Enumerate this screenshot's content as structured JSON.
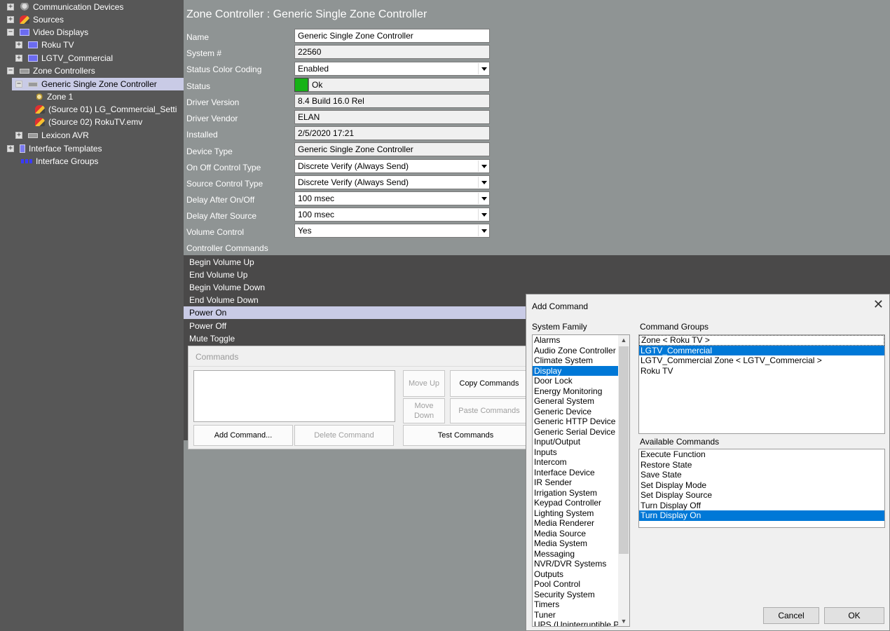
{
  "tree": {
    "items": [
      {
        "label": "Communication Devices",
        "expander": "+",
        "icon": "comm-device-icon"
      },
      {
        "label": "Sources",
        "expander": "+",
        "icon": "source-icon"
      },
      {
        "label": "Video Displays",
        "expander": "−",
        "icon": "monitor-icon"
      },
      {
        "label": "Roku TV",
        "expander": "+",
        "icon": "monitor-icon"
      },
      {
        "label": "LGTV_Commercial",
        "expander": "+",
        "icon": "monitor-icon"
      },
      {
        "label": "Zone Controllers",
        "expander": "−",
        "icon": "zone-controller-icon"
      },
      {
        "label": "Generic Single Zone Controller",
        "expander": "−",
        "icon": "zone-controller-icon"
      },
      {
        "label": "Zone 1",
        "icon": "speaker-icon"
      },
      {
        "label": "(Source 01) LG_Commercial_Setti",
        "icon": "source-icon"
      },
      {
        "label": "(Source 02) RokuTV.emv",
        "icon": "source-icon"
      },
      {
        "label": "Lexicon AVR",
        "expander": "+",
        "icon": "zone-controller-icon"
      },
      {
        "label": "Interface Templates",
        "expander": "+",
        "icon": "template-icon"
      },
      {
        "label": "Interface Groups",
        "icon": "group-icon"
      }
    ]
  },
  "main": {
    "title": "Zone Controller : Generic Single Zone Controller",
    "props": {
      "name_label": "Name",
      "name_value": "Generic Single Zone Controller",
      "system_label": "System #",
      "system_value": "22560",
      "color_label": "Status Color Coding",
      "color_value": "Enabled",
      "status_label": "Status",
      "status_value": "Ok",
      "status_color": "#16b216",
      "driver_label": "Driver Version",
      "driver_value": "8.4 Build 16.0 Rel",
      "vendor_label": "Driver Vendor",
      "vendor_value": "ELAN",
      "installed_label": "Installed",
      "installed_value": "2/5/2020 17:21",
      "devtype_label": "Device Type",
      "devtype_value": "Generic Single Zone Controller",
      "onoff_label": "On Off Control Type",
      "onoff_value": "Discrete Verify (Always Send)",
      "srcctl_label": "Source Control Type",
      "srcctl_value": "Discrete Verify (Always Send)",
      "delay_onoff_label": "Delay After On/Off",
      "delay_onoff_value": "100 msec",
      "delay_src_label": "Delay After Source",
      "delay_src_value": "100 msec",
      "volume_label": "Volume Control",
      "volume_value": "Yes"
    },
    "controller_commands_label": "Controller Commands",
    "commands": [
      "Begin Volume Up",
      "End Volume Up",
      "Begin Volume Down",
      "End Volume Down",
      "Power On",
      "Power Off",
      "Mute Toggle"
    ],
    "panel": {
      "title": "Commands",
      "move_up": "Move Up",
      "move_down": "Move Down",
      "copy": "Copy Commands",
      "paste": "Paste Commands",
      "add": "Add Command...",
      "delete": "Delete Command",
      "test": "Test Commands"
    }
  },
  "dialog": {
    "title": "Add Command",
    "close": "✕",
    "system_family_label": "System Family",
    "system_families": [
      "Alarms",
      "Audio Zone Controller",
      "Climate System",
      "Display",
      "Door Lock",
      "Energy Monitoring",
      "General System",
      "Generic Device",
      "Generic HTTP Device",
      "Generic Serial Device",
      "Input/Output",
      "Inputs",
      "Intercom",
      "Interface Device",
      "IR Sender",
      "Irrigation System",
      "Keypad Controller",
      "Lighting System",
      "Media Renderer",
      "Media Source",
      "Media System",
      "Messaging",
      "NVR/DVR Systems",
      "Outputs",
      "Pool Control",
      "Security System",
      "Timers",
      "Tuner",
      "UPS (Uninterruptible P"
    ],
    "selected_family": "Display",
    "command_groups_label": "Command Groups",
    "command_groups": [
      "Zone < Roku TV >",
      "LGTV_Commercial",
      "LGTV_Commercial Zone < LGTV_Commercial >",
      "Roku TV"
    ],
    "selected_group": "LGTV_Commercial",
    "available_label": "Available Commands",
    "available_commands": [
      "Execute Function",
      "Restore State",
      "Save State",
      "Set Display Mode",
      "Set Display Source",
      "Turn Display Off",
      "Turn Display On"
    ],
    "selected_command": "Turn Display On",
    "cancel": "Cancel",
    "ok": "OK",
    "accent": "#0078d7"
  }
}
